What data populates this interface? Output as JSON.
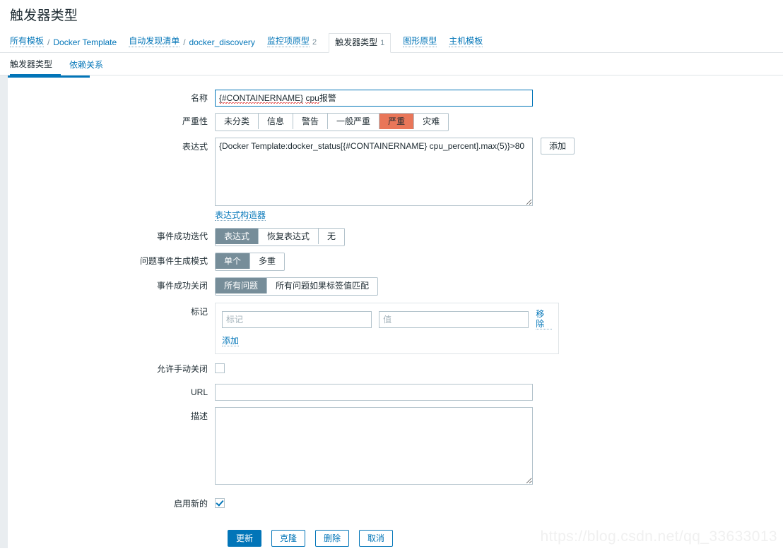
{
  "page": {
    "title": "触发器类型",
    "watermark": "https://blog.csdn.net/qq_33633013"
  },
  "breadcrumb": {
    "items": [
      {
        "label": "所有模板",
        "type": "link"
      },
      {
        "label": "Docker Template",
        "type": "plain"
      },
      {
        "label": "自动发现清单",
        "type": "link"
      },
      {
        "label": "docker_discovery",
        "type": "plain"
      },
      {
        "label": "监控项原型",
        "count": "2",
        "type": "link"
      },
      {
        "label": "触发器类型",
        "count": "1",
        "type": "selected"
      },
      {
        "label": "图形原型",
        "type": "link"
      },
      {
        "label": "主机模板",
        "type": "link"
      }
    ],
    "separator": "/"
  },
  "tabs": [
    {
      "label": "触发器类型",
      "active": true
    },
    {
      "label": "依赖关系",
      "active": false
    }
  ],
  "form": {
    "name": {
      "label": "名称",
      "value_prefix": "{#CONTAINERNAME}",
      "value_mid": " ",
      "value_spell": "cpu",
      "value_suffix": "报警",
      "value": "{#CONTAINERNAME} cpu报警"
    },
    "severity": {
      "label": "严重性",
      "options": [
        "未分类",
        "信息",
        "警告",
        "一般严重",
        "严重",
        "灾难"
      ],
      "selected": "严重",
      "selected_color": "#e97659"
    },
    "expression": {
      "label": "表达式",
      "value": "{Docker Template:docker_status[{#CONTAINERNAME} cpu_percent].max(5)}>80",
      "add_button": "添加",
      "constructor_link": "表达式构造器"
    },
    "ok_event_generation": {
      "label": "事件成功迭代",
      "options": [
        "表达式",
        "恢复表达式",
        "无"
      ],
      "selected": "表达式"
    },
    "problem_event_generation": {
      "label": "问题事件生成模式",
      "options": [
        "单个",
        "多重"
      ],
      "selected": "单个"
    },
    "ok_event_closes": {
      "label": "事件成功关闭",
      "options": [
        "所有问题",
        "所有问题如果标签值匹配"
      ],
      "selected": "所有问题"
    },
    "tags": {
      "label": "标记",
      "rows": [
        {
          "name_value": "",
          "name_placeholder": "标记",
          "value_value": "",
          "value_placeholder": "值",
          "remove_label": "移除"
        }
      ],
      "add_label": "添加"
    },
    "allow_manual_close": {
      "label": "允许手动关闭",
      "checked": false
    },
    "url": {
      "label": "URL",
      "value": "",
      "placeholder": ""
    },
    "description": {
      "label": "描述",
      "value": "",
      "placeholder": ""
    },
    "enabled": {
      "label": "启用新的",
      "checked": true
    }
  },
  "footer": {
    "buttons": [
      {
        "label": "更新",
        "style": "primary"
      },
      {
        "label": "克隆",
        "style": "outline"
      },
      {
        "label": "删除",
        "style": "outline"
      },
      {
        "label": "取消",
        "style": "outline"
      }
    ]
  },
  "colors": {
    "accent": "#0275b8",
    "selected_gray": "#768d99",
    "severity_high": "#e97659",
    "border": "#b3c3cc"
  }
}
